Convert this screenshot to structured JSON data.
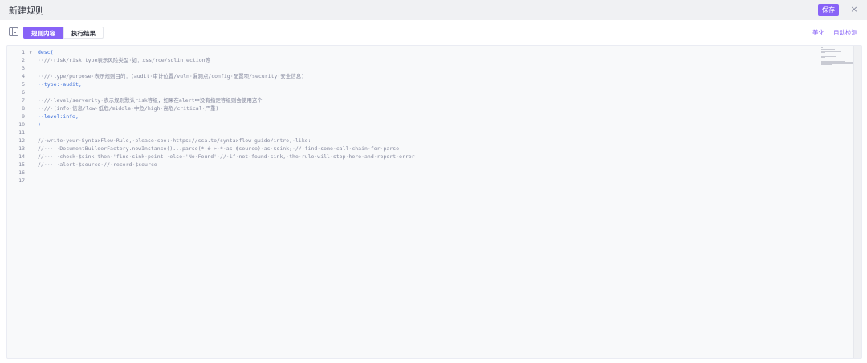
{
  "header": {
    "title": "新建规则",
    "save_label": "保存",
    "close_label": "×"
  },
  "toolbar": {
    "tabs": [
      {
        "label": "规则内容",
        "active": true
      },
      {
        "label": "执行结果",
        "active": false
      }
    ],
    "beautify_label": "美化",
    "autocheck_label": "自动检测"
  },
  "editor": {
    "lines": [
      {
        "n": "1",
        "fold": "∨",
        "text": "desc("
      },
      {
        "n": "2",
        "text": "··//·risk/risk_type表示风险类型·如：xss/rce/sqlinjection等"
      },
      {
        "n": "3",
        "text": ""
      },
      {
        "n": "4",
        "text": "··//·type/purpose·表示规则目的：(audit·审计位置/vuln·漏洞点/config·配置项/security·安全信息)"
      },
      {
        "n": "5",
        "text": "··type:·audit,"
      },
      {
        "n": "6",
        "text": ""
      },
      {
        "n": "7",
        "text": "··//·level/serverity·表示规则默认risk等级，如果在alert中没有指定等级则会使用这个"
      },
      {
        "n": "8",
        "text": "··//·(info·信息/low·低危/middle·中危/high·高危/critical·严重)"
      },
      {
        "n": "9",
        "text": "··level:info,"
      },
      {
        "n": "10",
        "text": ")"
      },
      {
        "n": "11",
        "text": ""
      },
      {
        "n": "12",
        "text": "//·write·your·SyntaxFlow·Rule,·please·see:·https://ssa.to/syntaxflow-guide/intro,·like:"
      },
      {
        "n": "13",
        "text": "//·····DocumentBuilderFactory.newInstance()...parse(*·#->·*·as·$source)·as·$sink;·//·find·some·call·chain·for·parse"
      },
      {
        "n": "14",
        "text": "//·····check·$sink·then·'find·sink·point'·else·'No·Found'·//·if·not·found·sink,·the·rule·will·stop·here·and·report·error"
      },
      {
        "n": "15",
        "text": "//·····alert·$source·//·record·$source"
      },
      {
        "n": "16",
        "text": ""
      },
      {
        "n": "17",
        "text": ""
      }
    ]
  },
  "colors": {
    "accent": "#8863f7",
    "keyword": "#3b6ed9",
    "comment": "#85899e"
  }
}
